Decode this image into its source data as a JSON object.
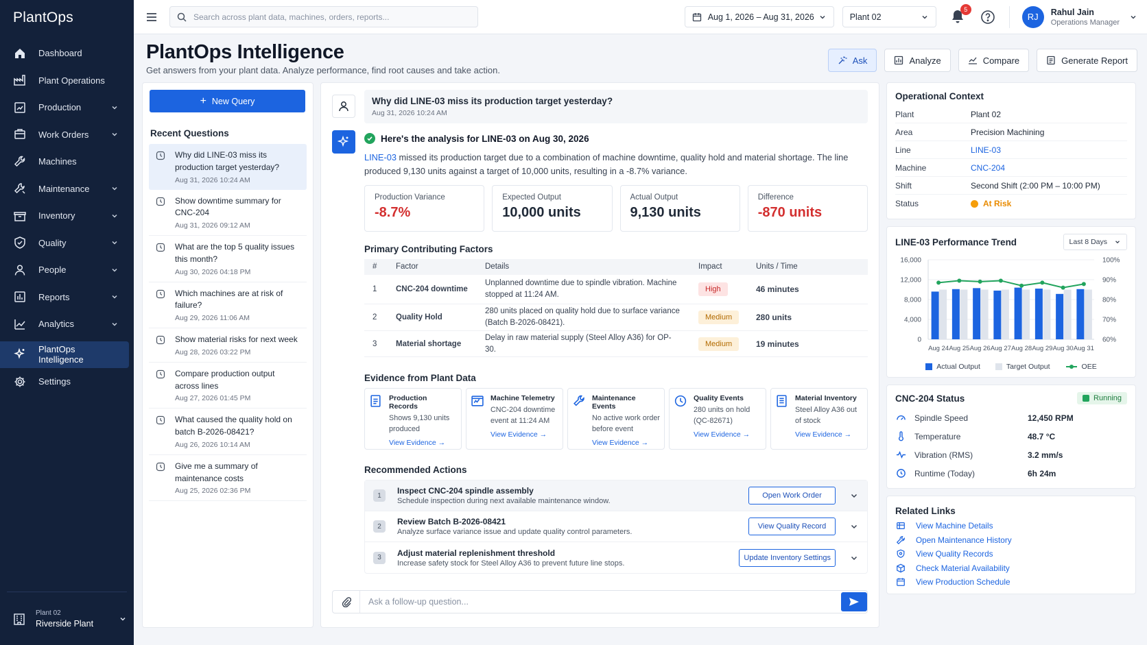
{
  "app": {
    "logo": "PlantOps"
  },
  "sidebar": {
    "items": [
      {
        "label": "Dashboard",
        "icon": "home-icon",
        "chevron": false
      },
      {
        "label": "Plant Operations",
        "icon": "factory-icon",
        "chevron": false
      },
      {
        "label": "Production",
        "icon": "production-icon",
        "chevron": true
      },
      {
        "label": "Work Orders",
        "icon": "work-orders-icon",
        "chevron": true
      },
      {
        "label": "Machines",
        "icon": "wrench-icon",
        "chevron": false
      },
      {
        "label": "Maintenance",
        "icon": "maintenance-icon",
        "chevron": true
      },
      {
        "label": "Inventory",
        "icon": "inventory-icon",
        "chevron": true
      },
      {
        "label": "Quality",
        "icon": "shield-check-icon",
        "chevron": true
      },
      {
        "label": "People",
        "icon": "person-icon",
        "chevron": true
      },
      {
        "label": "Reports",
        "icon": "reports-icon",
        "chevron": true
      },
      {
        "label": "Analytics",
        "icon": "analytics-icon",
        "chevron": true
      },
      {
        "label": "PlantOps Intelligence",
        "icon": "sparkle-icon",
        "chevron": false,
        "active": true
      },
      {
        "label": "Settings",
        "icon": "gear-icon",
        "chevron": false
      }
    ],
    "footer": {
      "small": "Plant 02",
      "big": "Riverside Plant"
    }
  },
  "topbar": {
    "search_placeholder": "Search across plant data, machines, orders, reports...",
    "date_range": "Aug 1, 2026 – Aug 31, 2026",
    "plant": "Plant 02",
    "notifications": "5",
    "user": {
      "initials": "RJ",
      "name": "Rahul Jain",
      "role": "Operations Manager"
    }
  },
  "header": {
    "title": "PlantOps Intelligence",
    "subtitle": "Get answers from your plant data. Analyze performance, find root causes and take action.",
    "actions": {
      "ask": "Ask",
      "analyze": "Analyze",
      "compare": "Compare",
      "report": "Generate Report"
    }
  },
  "recent": {
    "new_query": "New Query",
    "title": "Recent Questions",
    "items": [
      {
        "q": "Why did LINE-03 miss its production target yesterday?",
        "d": "Aug 31, 2026 10:24 AM"
      },
      {
        "q": "Show downtime summary for CNC-204",
        "d": "Aug 31, 2026 09:12 AM"
      },
      {
        "q": "What are the top 5 quality issues this month?",
        "d": "Aug 30, 2026 04:18 PM"
      },
      {
        "q": "Which machines are at risk of failure?",
        "d": "Aug 29, 2026 11:06 AM"
      },
      {
        "q": "Show material risks for next week",
        "d": "Aug 28, 2026 03:22 PM"
      },
      {
        "q": "Compare production output across lines",
        "d": "Aug 27, 2026 01:45 PM"
      },
      {
        "q": "What caused the quality hold on batch B-2026-08421?",
        "d": "Aug 26, 2026 10:14 AM"
      },
      {
        "q": "Give me a summary of maintenance costs",
        "d": "Aug 25, 2026 02:36 PM"
      }
    ]
  },
  "chat": {
    "question": "Why did LINE-03 miss its production target yesterday?",
    "question_date": "Aug 31, 2026 10:24 AM",
    "answer_head": "Here's the analysis for LINE-03 on Aug 30, 2026",
    "answer_link": "LINE-03",
    "answer_text": " missed its production target due to a combination of machine downtime, quality hold and material shortage. The line produced 9,130 units against a target of 10,000 units, resulting in a -8.7% variance.",
    "kpis": [
      {
        "label": "Production Variance",
        "value": "-8.7%",
        "red": true
      },
      {
        "label": "Expected Output",
        "value": "10,000 units",
        "red": false
      },
      {
        "label": "Actual Output",
        "value": "9,130 units",
        "red": false
      },
      {
        "label": "Difference",
        "value": "-870 units",
        "red": true
      }
    ],
    "factors_title": "Primary Contributing Factors",
    "factors_headers": {
      "num": "#",
      "factor": "Factor",
      "details": "Details",
      "impact": "Impact",
      "units": "Units / Time"
    },
    "factors": [
      {
        "num": "1",
        "factor": "CNC-204 downtime",
        "details": "Unplanned downtime due to spindle vibration. Machine stopped at 11:24 AM.",
        "impact": "High",
        "units": "46 minutes"
      },
      {
        "num": "2",
        "factor": "Quality Hold",
        "details": "280 units placed on quality hold due to surface variance (Batch B-2026-08421).",
        "impact": "Medium",
        "units": "280 units"
      },
      {
        "num": "3",
        "factor": "Material shortage",
        "details": "Delay in raw material supply (Steel Alloy A36) for OP-30.",
        "impact": "Medium",
        "units": "19 minutes"
      }
    ],
    "evidence_title": "Evidence from Plant Data",
    "evidence": [
      {
        "title": "Production Records",
        "desc": "Shows 9,130 units produced",
        "link": "View Evidence",
        "icon": "document-icon"
      },
      {
        "title": "Machine Telemetry",
        "desc": "CNC-204 downtime event at 11:24 AM",
        "link": "View Evidence",
        "icon": "telemetry-icon"
      },
      {
        "title": "Maintenance Events",
        "desc": "No active work order before event",
        "link": "View Evidence",
        "icon": "wrench-icon"
      },
      {
        "title": "Quality Events",
        "desc": "280 units on hold (QC-82671)",
        "link": "View Evidence",
        "icon": "clock-icon"
      },
      {
        "title": "Material Inventory",
        "desc": "Steel Alloy A36 out of stock",
        "link": "View Evidence",
        "icon": "inventory-doc-icon"
      }
    ],
    "actions_title": "Recommended Actions",
    "actions": [
      {
        "num": "1",
        "title": "Inspect CNC-204 spindle assembly",
        "desc": "Schedule inspection during next available maintenance window.",
        "button": "Open Work Order"
      },
      {
        "num": "2",
        "title": "Review Batch B-2026-08421",
        "desc": "Analyze surface variance issue and update quality control parameters.",
        "button": "View Quality Record"
      },
      {
        "num": "3",
        "title": "Adjust material replenishment threshold",
        "desc": "Increase safety stock for Steel Alloy A36 to prevent future line stops.",
        "button": "Update Inventory Settings"
      }
    ],
    "followup_placeholder": "Ask a follow-up question..."
  },
  "context": {
    "title": "Operational Context",
    "rows": [
      {
        "k": "Plant",
        "v": "Plant 02",
        "type": "text"
      },
      {
        "k": "Area",
        "v": "Precision Machining",
        "type": "text"
      },
      {
        "k": "Line",
        "v": "LINE-03",
        "type": "link"
      },
      {
        "k": "Machine",
        "v": "CNC-204",
        "type": "link"
      },
      {
        "k": "Shift",
        "v": "Second Shift (2:00 PM – 10:00 PM)",
        "type": "text"
      },
      {
        "k": "Status",
        "v": "At Risk",
        "type": "risk"
      }
    ]
  },
  "trend": {
    "title": "LINE-03 Performance Trend",
    "range": "Last 8 Days",
    "legend": {
      "actual": "Actual Output",
      "target": "Target Output",
      "oee": "OEE"
    }
  },
  "chart_data": {
    "type": "bar",
    "categories": [
      "Aug 24",
      "Aug 25",
      "Aug 26",
      "Aug 27",
      "Aug 28",
      "Aug 29",
      "Aug 30",
      "Aug 31"
    ],
    "series": [
      {
        "name": "Actual Output",
        "values": [
          9600,
          10100,
          10300,
          9800,
          10400,
          10200,
          9130,
          10100
        ],
        "color": "#1c64e0"
      },
      {
        "name": "Target Output",
        "values": [
          10000,
          10000,
          10000,
          10000,
          10000,
          10000,
          10000,
          10000
        ],
        "color": "#dfe4ec"
      },
      {
        "name": "OEE",
        "values": [
          88.5,
          89.5,
          89,
          89.5,
          87,
          88.5,
          86,
          87.8
        ],
        "color": "#22a45d",
        "axis": "right"
      }
    ],
    "ylim": [
      0,
      16000
    ],
    "yticks": [
      "0",
      "4,000",
      "8,000",
      "12,000",
      "16,000"
    ],
    "y2lim": [
      60,
      100
    ],
    "y2ticks": [
      "60%",
      "70%",
      "80%",
      "90%",
      "100%"
    ],
    "grid": true,
    "legend_position": "bottom"
  },
  "machine_status": {
    "title": "CNC-204 Status",
    "state": "Running",
    "rows": [
      {
        "k": "Spindle Speed",
        "v": "12,450 RPM",
        "icon": "gauge-icon"
      },
      {
        "k": "Temperature",
        "v": "48.7 °C",
        "icon": "thermometer-icon"
      },
      {
        "k": "Vibration (RMS)",
        "v": "3.2 mm/s",
        "icon": "pulse-icon"
      },
      {
        "k": "Runtime (Today)",
        "v": "6h 24m",
        "icon": "clock-icon"
      }
    ]
  },
  "related": {
    "title": "Related Links",
    "links": [
      {
        "label": "View Machine Details",
        "icon": "machine-icon"
      },
      {
        "label": "Open Maintenance History",
        "icon": "wrench-icon"
      },
      {
        "label": "View Quality Records",
        "icon": "shield-icon"
      },
      {
        "label": "Check Material Availability",
        "icon": "cube-icon"
      },
      {
        "label": "View Production Schedule",
        "icon": "calendar-icon"
      }
    ]
  },
  "colors": {
    "sidebar": "#13213a",
    "accent": "#1c64e0",
    "danger": "#d32f2f",
    "warning": "#f59e0b",
    "success": "#22a45d"
  }
}
